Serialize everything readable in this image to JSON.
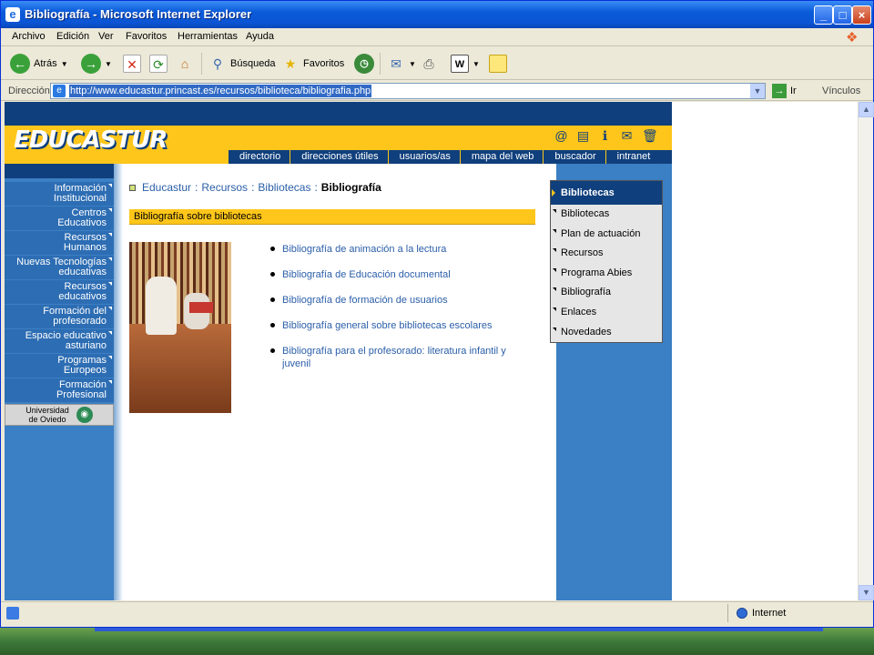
{
  "window": {
    "title": "Bibliografía - Microsoft Internet Explorer"
  },
  "menu": [
    "Archivo",
    "Edición",
    "Ver",
    "Favoritos",
    "Herramientas",
    "Ayuda"
  ],
  "toolbar": {
    "back": "Atrás",
    "search": "Búsqueda",
    "favorites": "Favoritos"
  },
  "address": {
    "label": "Dirección",
    "url": "http://www.educastur.princast.es/recursos/biblioteca/bibliografia.php",
    "go": "Ir",
    "links": "Vínculos"
  },
  "status": {
    "zone": "Internet"
  },
  "site": {
    "logo": "EDUCASTUR",
    "topnav": [
      "directorio",
      "direcciones útiles",
      "usuarios/as",
      "mapa del web",
      "buscador",
      "intranet"
    ],
    "leftnav": [
      [
        "Información",
        "Institucional"
      ],
      [
        "Centros",
        "Educativos"
      ],
      [
        "Recursos",
        "Humanos"
      ],
      [
        "Nuevas Tecnologías",
        "educativas"
      ],
      [
        "Recursos",
        "educativos"
      ],
      [
        "Formación del",
        "profesorado"
      ],
      [
        "Espacio educativo",
        "asturiano"
      ],
      [
        "Programas",
        "Europeos"
      ],
      [
        "Formación",
        "Profesional"
      ]
    ],
    "university": [
      "Universidad",
      "de Oviedo"
    ],
    "breadcrumb": [
      "Educastur",
      "Recursos",
      "Bibliotecas",
      "Bibliografía"
    ],
    "section_title": "Bibliografía sobre bibliotecas",
    "links": [
      "Bibliografía de animación a la lectura",
      "Bibliografía de Educación documental",
      "Bibliografía de formación de usuarios",
      "Bibliografía general sobre bibliotecas escolares",
      "Bibliografía para el profesorado: literatura infantil y juvenil"
    ],
    "rightmenu": {
      "header": "Bibliotecas",
      "items": [
        "Bibliotecas",
        "Plan de actuación",
        "Recursos",
        "Programa Abies",
        "Bibliografía",
        "Enlaces",
        "Novedades"
      ]
    }
  }
}
